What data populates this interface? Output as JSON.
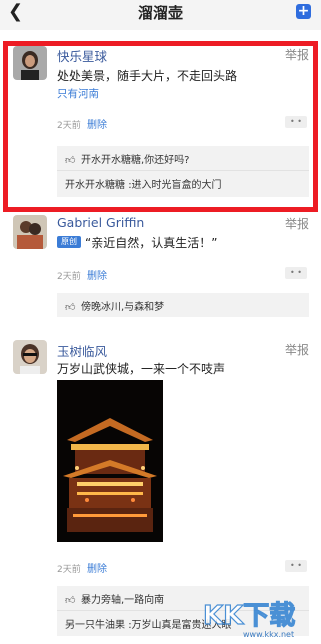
{
  "header": {
    "title": "溜溜壶",
    "back_icon": "chevron-left-icon",
    "add_icon": "plus-square-icon"
  },
  "posts": [
    {
      "name": "快乐星球",
      "report": "举报",
      "text": "处处美景，随手大片，不走回头路",
      "location": "只有河南",
      "time": "2天前",
      "delete": "删除",
      "likes": "开水开水糖糖,你还好吗?",
      "comment_user": "开水开水糖糖",
      "comment_text": ":进入时光盲盒的大门"
    },
    {
      "name": "Gabriel Griffin",
      "report": "举报",
      "badge": "原创",
      "text": "“亲近自然，认真生活！”",
      "time": "2天前",
      "delete": "删除",
      "likes": "傍晚冰川,与森和梦"
    },
    {
      "name": "玉树临风",
      "report": "举报",
      "text": "万岁山武侠城，一来一个不吱声",
      "time": "2天前",
      "delete": "删除",
      "likes": "暴力旁轴,一路向南",
      "comment_user": "另一只牛油果",
      "comment_text": ":万岁山真是富贵迷人眼"
    }
  ],
  "watermark": {
    "text": "KK下载",
    "url": "www.kkx.net"
  },
  "colors": {
    "accent": "#3b7cd6",
    "highlight": "#ed1c24",
    "name": "#3a5a9c"
  }
}
